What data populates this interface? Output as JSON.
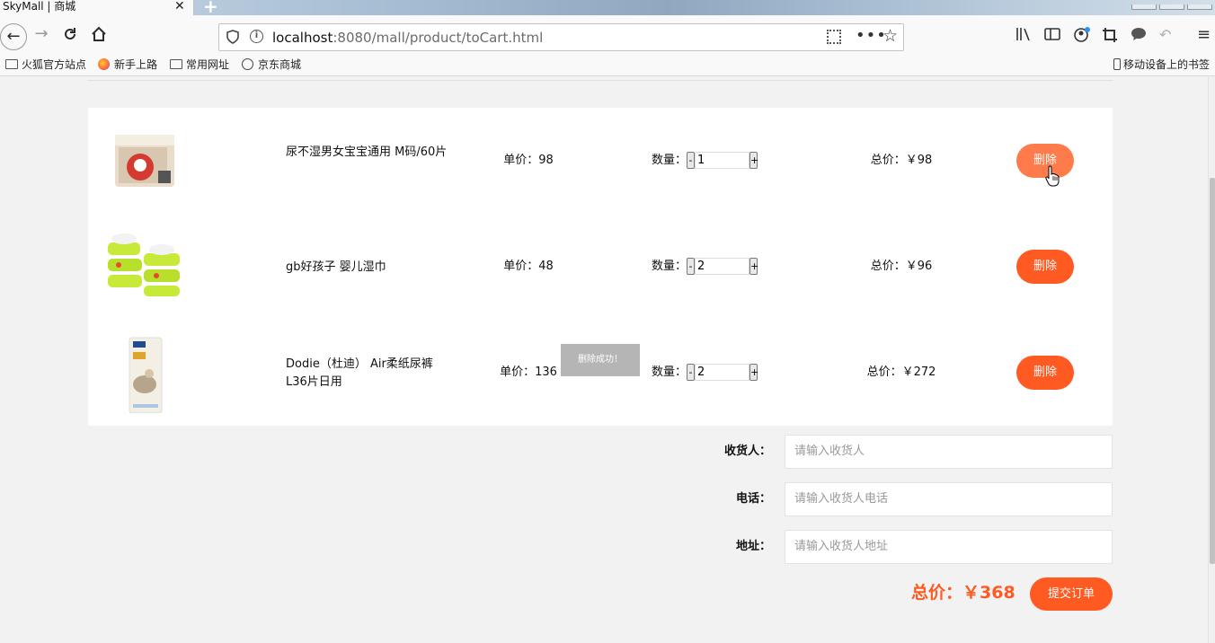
{
  "browser": {
    "tab_title": "SkyMall | 商城",
    "tab_close": "✕",
    "new_tab": "+",
    "url_host": "localhost",
    "url_rest": ":8080/mall/product/toCart.html",
    "bookmarks": [
      "火狐官方站点",
      "新手上路",
      "常用网址",
      "京东商城"
    ],
    "mobile_bookmarks": "移动设备上的书签"
  },
  "cart": {
    "items": [
      {
        "name": "尿不湿男女宝宝通用 M码/60片",
        "price_label": "单价：98",
        "qty_label": "数量：",
        "qty": "1",
        "total_label": "总价：￥98",
        "delete_label": "删除"
      },
      {
        "name": "gb好孩子 婴儿湿巾",
        "price_label": "单价：48",
        "qty_label": "数量：",
        "qty": "2",
        "total_label": "总价：￥96",
        "delete_label": "删除"
      },
      {
        "name": "Dodie（杜迪） Air柔纸尿裤L36片日用",
        "price_label": "单价：136",
        "qty_label": "数量：",
        "qty": "2",
        "total_label": "总价：￥272",
        "delete_label": "删除"
      }
    ],
    "minus": "-",
    "plus": "+"
  },
  "toast": "删除成功！",
  "form": {
    "receiver_label": "收货人：",
    "receiver_placeholder": "请输入收货人",
    "phone_label": "电话：",
    "phone_placeholder": "请输入收货人电话",
    "address_label": "地址：",
    "address_placeholder": "请输入收货人地址"
  },
  "summary": {
    "grand_total": "总价：￥368",
    "submit_label": "提交订单"
  },
  "colors": {
    "accent": "#ff5a22",
    "hover": "#ff7b4b",
    "toast": "#b5b5b5"
  }
}
